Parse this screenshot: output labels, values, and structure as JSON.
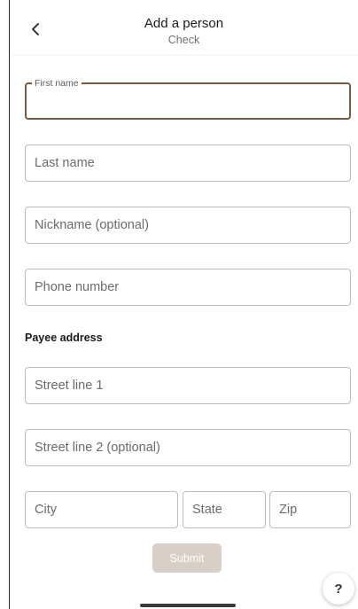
{
  "header": {
    "title": "Add a person",
    "subtitle": "Check",
    "back_icon": "chevron-left-icon"
  },
  "form": {
    "first_name": {
      "label": "First name",
      "value": ""
    },
    "last_name": {
      "placeholder": "Last name"
    },
    "nickname": {
      "placeholder": "Nickname (optional)"
    },
    "phone": {
      "placeholder": "Phone number"
    },
    "payee_address_label": "Payee address",
    "street1": {
      "placeholder": "Street line 1"
    },
    "street2": {
      "placeholder": "Street line 2 (optional)"
    },
    "city": {
      "placeholder": "City"
    },
    "state": {
      "placeholder": "State"
    },
    "zip": {
      "placeholder": "Zip"
    },
    "submit_label": "Submit"
  },
  "help": {
    "label": "?"
  },
  "colors": {
    "focus_border": "#7a5a3e",
    "submit_disabled_bg": "#d8cfc6",
    "field_border": "#bdbdbd"
  }
}
